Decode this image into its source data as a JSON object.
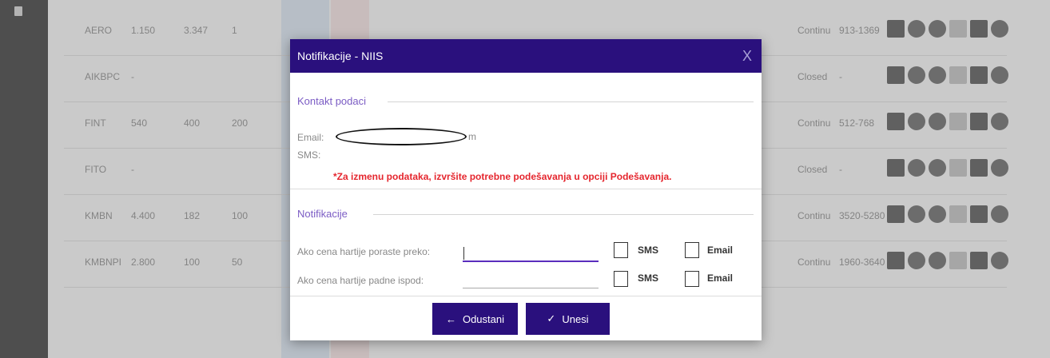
{
  "modal": {
    "title": "Notifikacije - NIIS",
    "close": "X",
    "contact_section": "Kontakt podaci",
    "email_label": "Email:",
    "email_suffix": "m",
    "sms_label": "SMS:",
    "warning": "*Za izmenu podataka, izvršite potrebne podešavanja u opciji Podešavanja.",
    "notif_section": "Notifikacije",
    "rise_label": "Ako cena hartije poraste preko:",
    "fall_label": "Ako cena hartije padne ispod:",
    "rise_value": "",
    "fall_value": "",
    "sms_cb": "SMS",
    "email_cb": "Email",
    "cancel_button": "Odustani",
    "cancel_icon": "←",
    "submit_button": "Unesi",
    "submit_icon": "✓"
  },
  "table": {
    "rows": [
      {
        "symbol": "AERO",
        "a": "1.150",
        "b": "3.347",
        "c": "1",
        "status": "Continu",
        "range": "913-1369"
      },
      {
        "symbol": "AIKBPC",
        "a": "-",
        "b": "",
        "c": "",
        "status": "Closed",
        "range": "-"
      },
      {
        "symbol": "FINT",
        "a": "540",
        "b": "400",
        "c": "200",
        "status": "Continu",
        "range": "512-768"
      },
      {
        "symbol": "FITO",
        "a": "-",
        "b": "",
        "c": "",
        "status": "Closed",
        "range": "-"
      },
      {
        "symbol": "KMBN",
        "a": "4.400",
        "b": "182",
        "c": "100",
        "status": "Continu",
        "range": "3520-5280"
      },
      {
        "symbol": "KMBNPI",
        "a": "2.800",
        "b": "100",
        "c": "50",
        "status": "Continu",
        "range": "1960-3640"
      }
    ]
  },
  "colors": {
    "accent": "#2a107d",
    "warning": "#e5262e",
    "legend": "#7b5cc4"
  }
}
